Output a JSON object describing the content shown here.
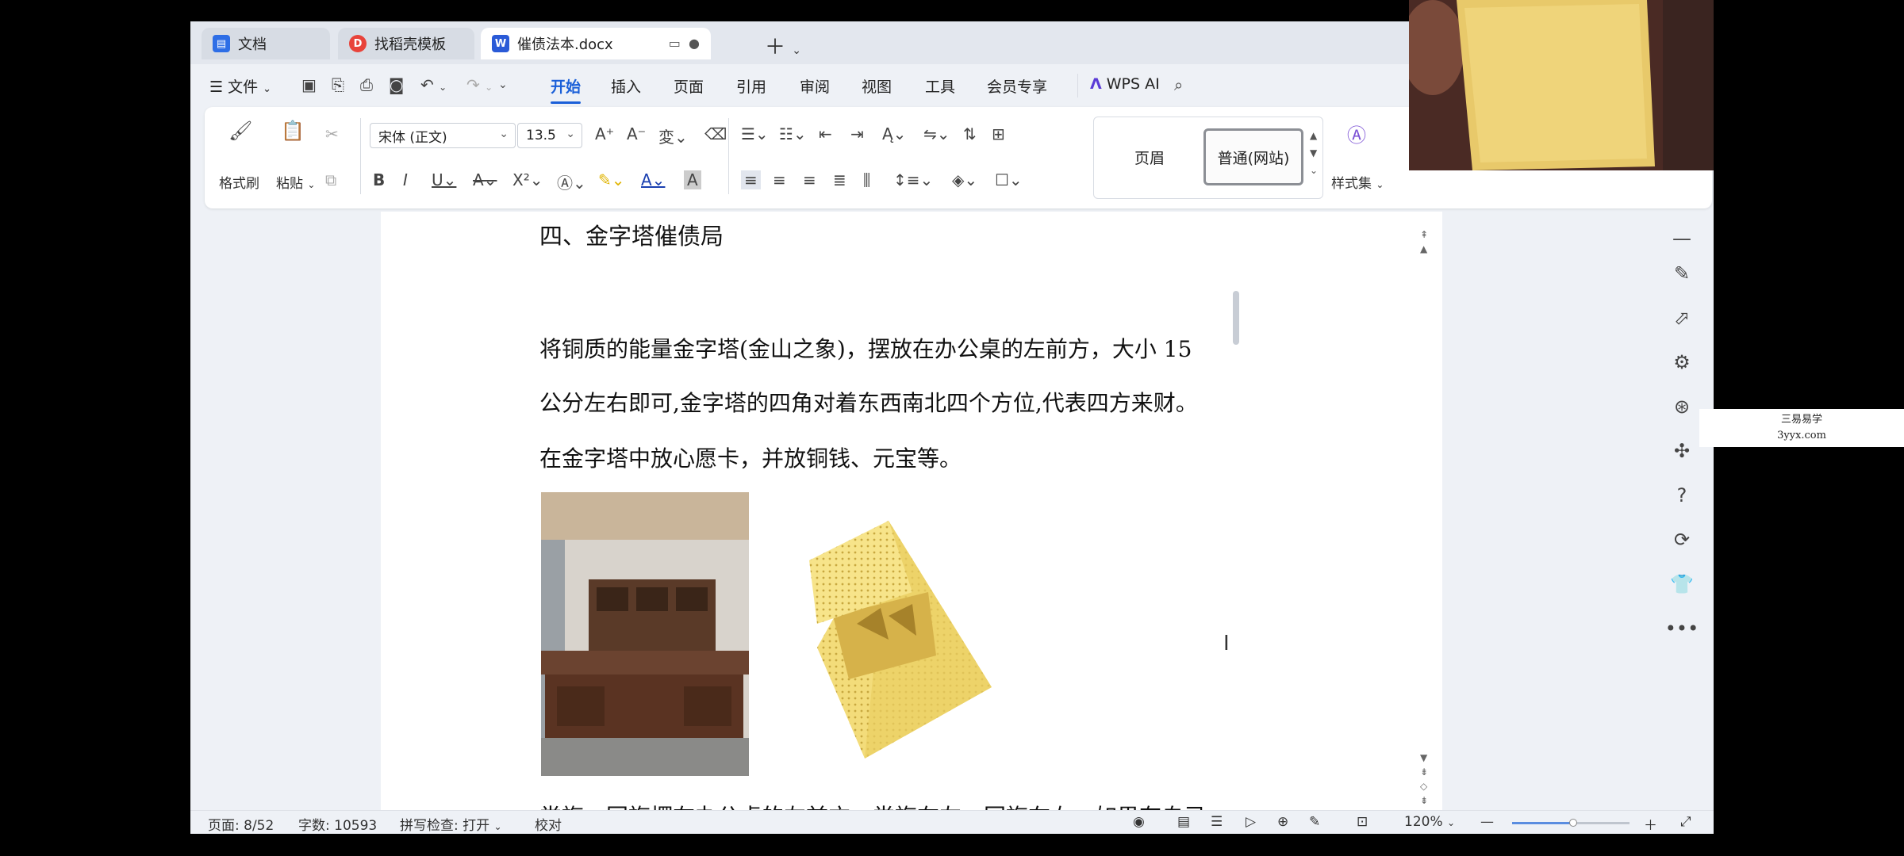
{
  "tabs": [
    {
      "label": "文档",
      "icon": "docs-icon",
      "active": false
    },
    {
      "label": "找稻壳模板",
      "icon": "docer-icon",
      "active": false
    },
    {
      "label": "催债法本.docx",
      "icon": "word-icon",
      "active": true
    }
  ],
  "menu": {
    "file_label": "文件",
    "items": [
      "开始",
      "插入",
      "页面",
      "引用",
      "审阅",
      "视图",
      "工具",
      "会员专享"
    ],
    "active": "开始",
    "ai_label": "WPS AI"
  },
  "ribbon": {
    "format_painter": "格式刷",
    "paste": "粘贴",
    "font_name": "宋体 (正文)",
    "font_size": "13.5",
    "style_header": "页眉",
    "style_selected": "普通(网站)",
    "style_set": "样式集"
  },
  "document": {
    "heading": "四、金字塔催债局",
    "paragraphs": [
      "将铜质的能量金字塔(金山之象)，摆放在办公桌的左前方，大小 15",
      "公分左右即可,金字塔的四角对着东西南北四个方位,代表四方来财。",
      "在金字塔中放心愿卡，并放铜钱、元宝等。"
    ],
    "last_line": "党旗、国旗摆在办公桌的左前方，党旗在左，国旗在右。如果有自己"
  },
  "status": {
    "page": "页面: 8/52",
    "word_count": "字数: 10593",
    "spell_check": "拼写检查: 打开",
    "proofread": "校对",
    "zoom": "120%"
  },
  "watermark": {
    "line1": "三易易学",
    "line2": "3yyx.com"
  },
  "colors": {
    "accent": "#1a5fd8",
    "page_bg": "#ffffff",
    "app_bg": "#eef1f6"
  }
}
